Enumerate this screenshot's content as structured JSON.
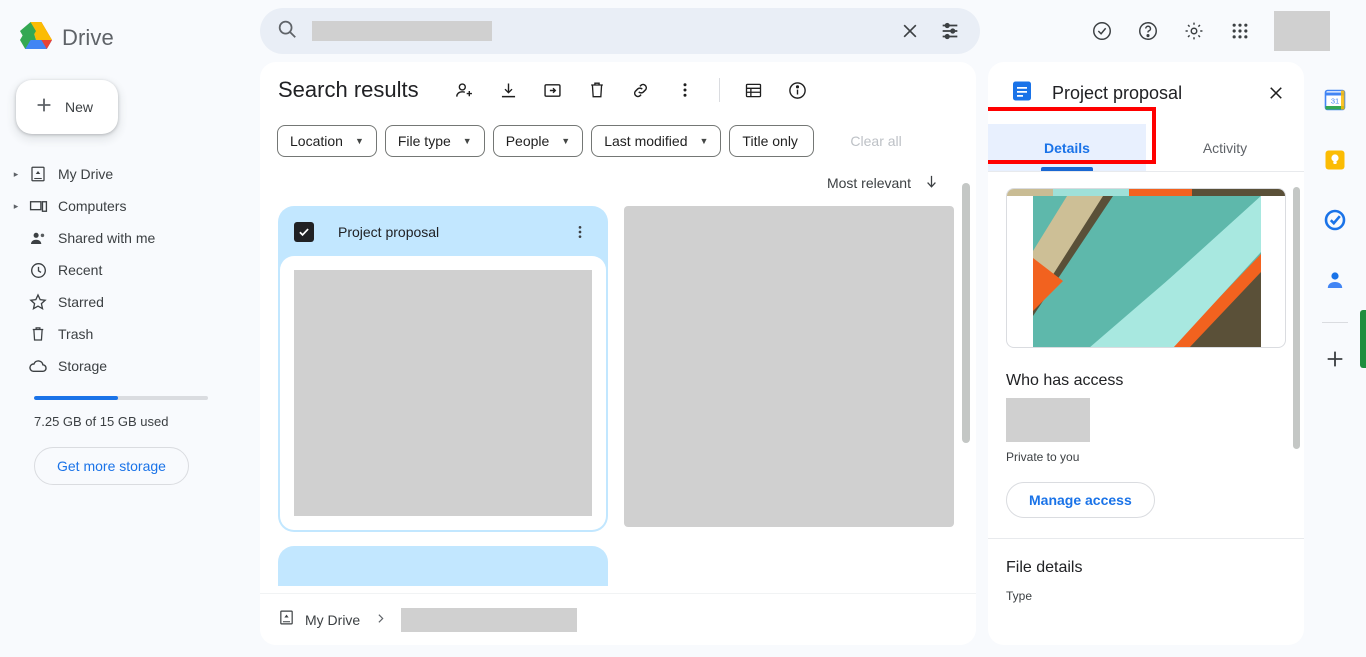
{
  "brand": {
    "name": "Drive",
    "logo_icon": "google-drive-logo"
  },
  "sidebar": {
    "new_button": {
      "label": "New",
      "icon": "plus-icon"
    },
    "items": [
      {
        "label": "My Drive",
        "icon": "my-drive-icon",
        "expandable": true
      },
      {
        "label": "Computers",
        "icon": "computers-icon",
        "expandable": true
      },
      {
        "label": "Shared with me",
        "icon": "people-icon",
        "expandable": false
      },
      {
        "label": "Recent",
        "icon": "clock-icon",
        "expandable": false
      },
      {
        "label": "Starred",
        "icon": "star-icon",
        "expandable": false
      },
      {
        "label": "Trash",
        "icon": "trash-icon",
        "expandable": false
      },
      {
        "label": "Storage",
        "icon": "cloud-icon",
        "expandable": false
      }
    ],
    "storage": {
      "used_text": "7.25 GB of 15 GB used",
      "percent": 48,
      "bar_color": "#1a73e8"
    },
    "get_more_storage": "Get more storage"
  },
  "search": {
    "placeholder": "",
    "value": "",
    "search_icon": "search-icon",
    "clear_icon": "close-icon",
    "options_icon": "tune-icon",
    "redacted": true
  },
  "topbar": {
    "icons": [
      {
        "name": "task-check-icon"
      },
      {
        "name": "help-icon"
      },
      {
        "name": "settings-gear-icon"
      },
      {
        "name": "apps-grid-icon"
      }
    ],
    "avatar_redacted": true
  },
  "main": {
    "title": "Search results",
    "toolbar": [
      {
        "name": "add-person-icon"
      },
      {
        "name": "download-icon"
      },
      {
        "name": "move-to-folder-icon"
      },
      {
        "name": "trash-icon"
      },
      {
        "name": "link-icon"
      },
      {
        "name": "more-vertical-icon"
      }
    ],
    "view_toggle_icon": "list-view-icon",
    "info_icon": "info-icon",
    "filters": [
      {
        "label": "Location",
        "has_dropdown": true
      },
      {
        "label": "File type",
        "has_dropdown": true
      },
      {
        "label": "People",
        "has_dropdown": true
      },
      {
        "label": "Last modified",
        "has_dropdown": true
      },
      {
        "label": "Title only",
        "has_dropdown": false,
        "clipped": true
      }
    ],
    "filters_next_icon": "chevron-right-icon",
    "clear_all": "Clear all",
    "sort": {
      "label": "Most relevant",
      "icon": "arrow-down-icon"
    },
    "files": [
      {
        "name": "Project proposal",
        "selected": true,
        "checkbox_icon": "check-icon",
        "menu_icon": "more-vertical-icon",
        "thumbnail_redacted": true
      },
      {
        "name": "",
        "selected": false,
        "redacted": true
      }
    ],
    "breadcrumb": {
      "icon": "my-drive-icon",
      "root": "My Drive",
      "separator_icon": "chevron-right-icon",
      "current_redacted": true
    }
  },
  "details_panel": {
    "file_icon": "google-docs-icon",
    "title": "Project proposal",
    "close_icon": "close-icon",
    "tabs": [
      {
        "label": "Details",
        "active": true,
        "highlighted": true
      },
      {
        "label": "Activity",
        "active": false,
        "highlighted": false
      }
    ],
    "preview": {
      "strip_colors": [
        "#c9bc94",
        "#9fe0d8",
        "#f2621f",
        "#5a5038"
      ],
      "art_colors": [
        "#9fe0d8",
        "#5eb8ab",
        "#cdbf96",
        "#5a5038",
        "#f2621f",
        "#a8e8e0"
      ]
    },
    "who_has_access": {
      "heading": "Who has access",
      "avatar_redacted": true,
      "status": "Private to you",
      "manage_button": "Manage access"
    },
    "file_details": {
      "heading": "File details",
      "type_label": "Type"
    }
  },
  "right_rail": {
    "items": [
      {
        "name": "google-calendar-icon",
        "label": "31"
      },
      {
        "name": "google-keep-icon"
      },
      {
        "name": "google-tasks-icon"
      },
      {
        "name": "google-contacts-icon"
      }
    ],
    "add_icon": "plus-icon"
  },
  "annotation": {
    "color": "#ff0000",
    "target": "Details"
  }
}
